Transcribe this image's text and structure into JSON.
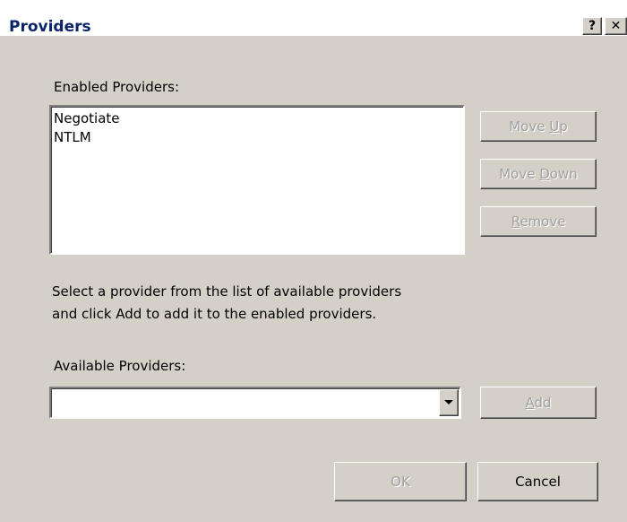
{
  "window": {
    "title": "Providers",
    "help_label": "?",
    "close_label": "✕"
  },
  "enabled": {
    "label": "Enabled Providers:",
    "items": [
      "Negotiate",
      "NTLM"
    ]
  },
  "buttons": {
    "move_up": {
      "pre": "Move ",
      "accel": "U",
      "post": "p"
    },
    "move_down": {
      "pre": "Move ",
      "accel": "D",
      "post": "own"
    },
    "remove": {
      "pre": "",
      "accel": "R",
      "post": "emove"
    },
    "add": {
      "pre": "",
      "accel": "A",
      "post": "dd"
    },
    "ok": "OK",
    "cancel": "Cancel"
  },
  "instructions": {
    "line1": "Select a provider from the list of available providers",
    "line2": "and click Add to add it to the enabled providers."
  },
  "available": {
    "label": "Available Providers:",
    "value": "",
    "icon": "chevron-down-icon"
  }
}
